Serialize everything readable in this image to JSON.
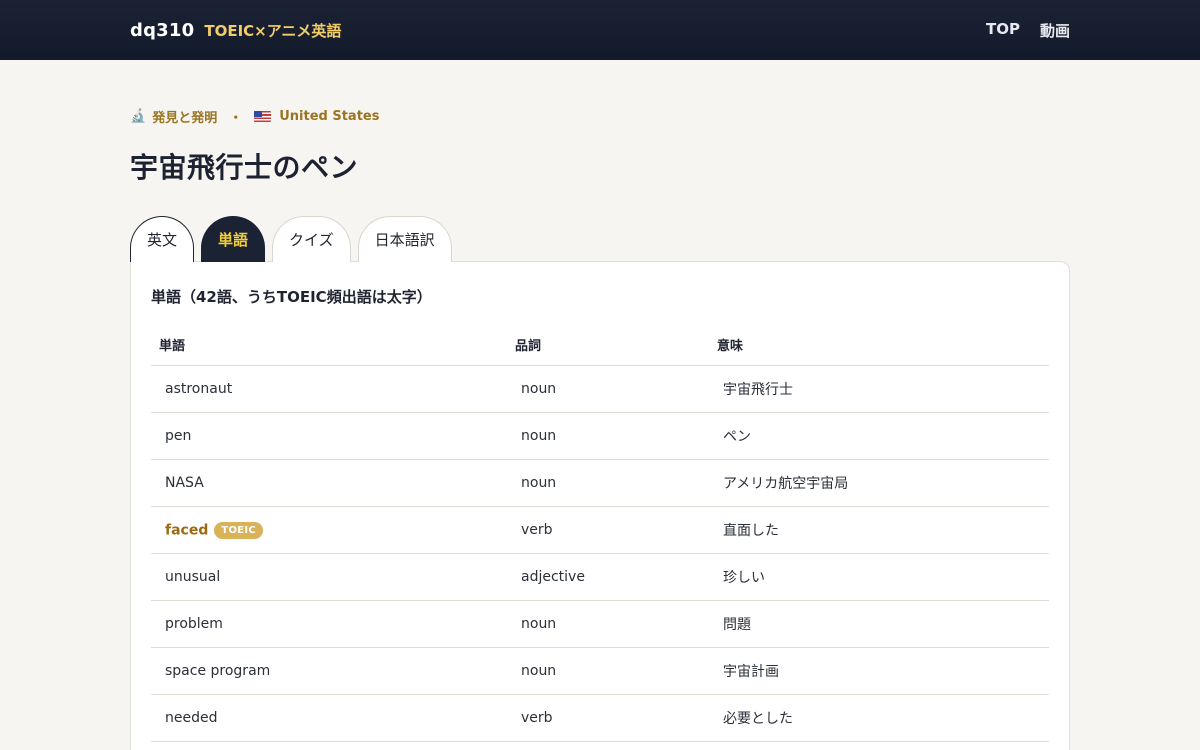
{
  "header": {
    "brand": "dq310",
    "subtitle": "TOEIC×アニメ英語",
    "nav": [
      "TOP",
      "動画"
    ]
  },
  "meta": {
    "category_icon": "microscope-icon",
    "category": "発見と発明",
    "separator": "・",
    "country_icon": "us-flag-icon",
    "country": "United States"
  },
  "title": "宇宙飛行士のペン",
  "tabs": [
    "英文",
    "単語",
    "クイズ",
    "日本語訳"
  ],
  "active_tab": "単語",
  "vocab": {
    "heading": "単語（42語、うちTOEIC頻出語は太字）",
    "columns": [
      "単語",
      "品詞",
      "意味"
    ],
    "badge_label": "TOEIC",
    "rows": [
      {
        "word": "astronaut",
        "pos": "noun",
        "meaning": "宇宙飛行士",
        "toeic": false
      },
      {
        "word": "pen",
        "pos": "noun",
        "meaning": "ペン",
        "toeic": false
      },
      {
        "word": "NASA",
        "pos": "noun",
        "meaning": "アメリカ航空宇宙局",
        "toeic": false
      },
      {
        "word": "faced",
        "pos": "verb",
        "meaning": "直面した",
        "toeic": true
      },
      {
        "word": "unusual",
        "pos": "adjective",
        "meaning": "珍しい",
        "toeic": false
      },
      {
        "word": "problem",
        "pos": "noun",
        "meaning": "問題",
        "toeic": false
      },
      {
        "word": "space program",
        "pos": "noun",
        "meaning": "宇宙計画",
        "toeic": false
      },
      {
        "word": "needed",
        "pos": "verb",
        "meaning": "必要とした",
        "toeic": false
      }
    ]
  },
  "colors": {
    "header_bg": "#1a2234",
    "accent_gold": "#f2cd6a",
    "meta_gold": "#9a7420",
    "toeic_word": "#9a6b14",
    "badge_bg": "#d9b25a",
    "page_bg": "#f6f5f1"
  }
}
